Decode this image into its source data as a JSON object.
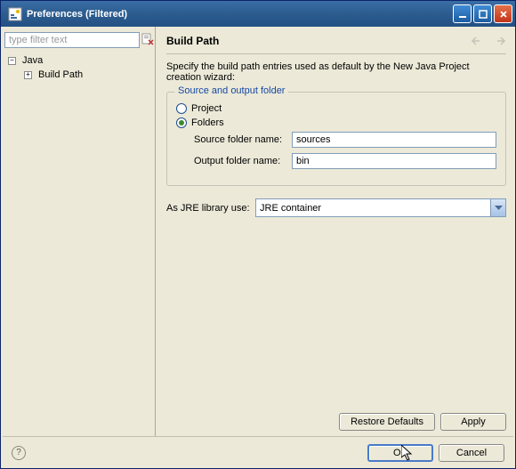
{
  "window": {
    "title": "Preferences (Filtered)"
  },
  "filter": {
    "placeholder": "type filter text"
  },
  "tree": {
    "root": "Java",
    "child": "Build Path"
  },
  "page": {
    "title": "Build Path",
    "description": "Specify the build path entries used as default by the New Java Project creation wizard:"
  },
  "group": {
    "title": "Source and output folder",
    "radio_project": "Project",
    "radio_folders": "Folders",
    "source_label": "Source folder name:",
    "source_value": "sources",
    "output_label": "Output folder name:",
    "output_value": "bin"
  },
  "jre": {
    "label": "As JRE library use:",
    "value": "JRE container"
  },
  "buttons": {
    "restore": "Restore Defaults",
    "apply": "Apply",
    "ok": "OK",
    "cancel": "Cancel"
  }
}
